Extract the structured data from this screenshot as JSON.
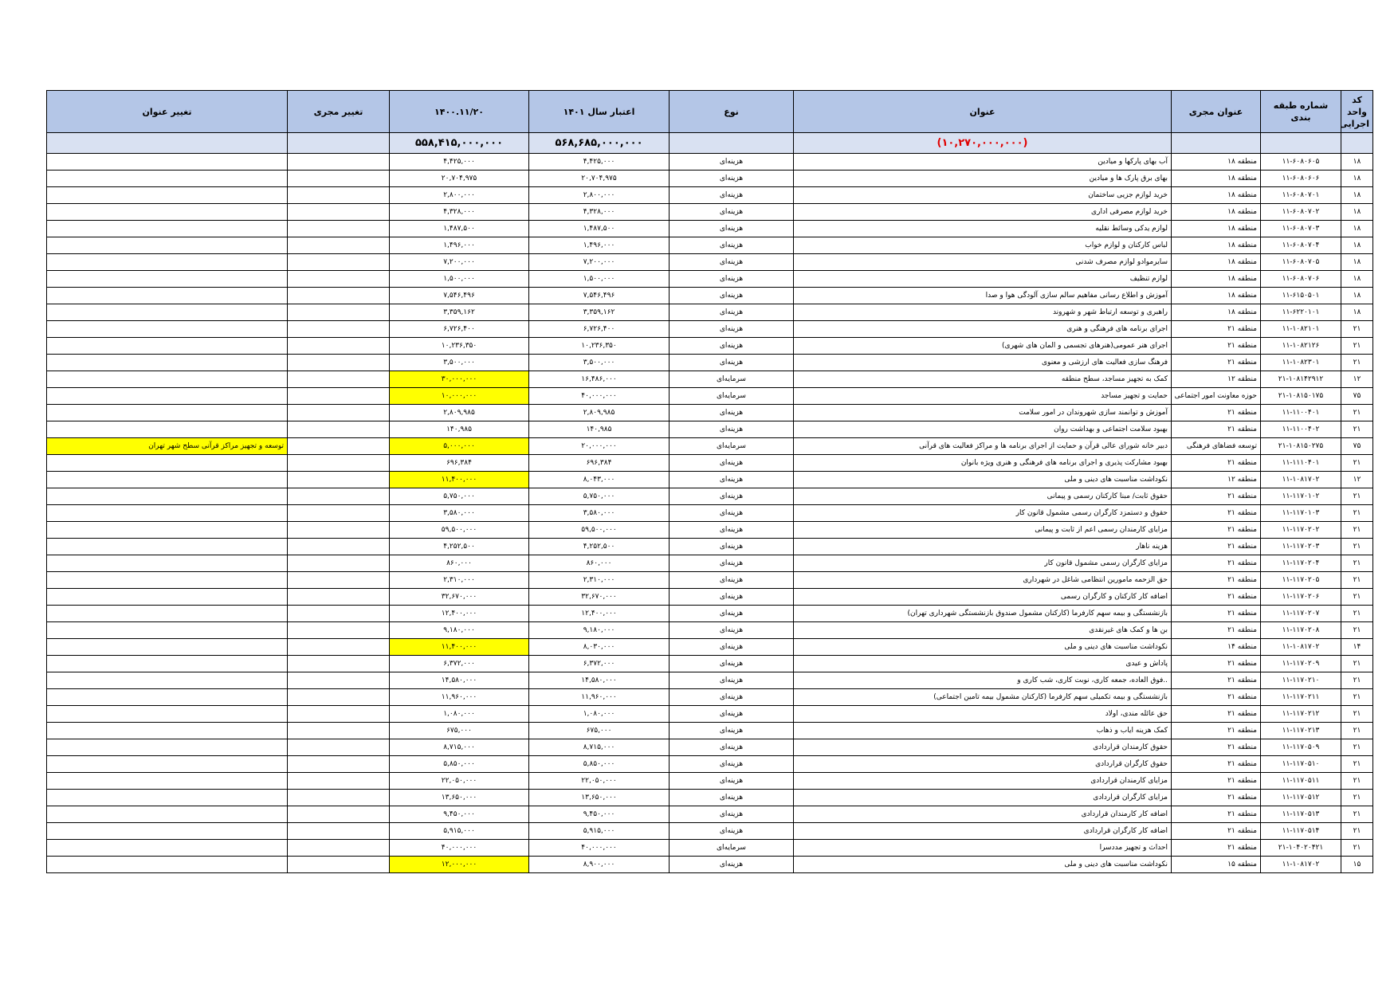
{
  "headers": {
    "code": "کد واحد اجرایی",
    "class_no": "شماره طبقه بندی",
    "unit_title": "عنوان مجری",
    "title": "عنوان",
    "type": "نوع",
    "credit": "اعتبار سال ۱۴۰۱",
    "date_col": "۱۴۰۰.۱۱/۲۰",
    "change_unit": "تغییر مجری",
    "change_title": "تغییر عنوان"
  },
  "totals": {
    "title_total": "(۱۰,۲۷۰,۰۰۰,۰۰۰)",
    "credit_total": "۵۶۸,۶۸۵,۰۰۰,۰۰۰",
    "date_total": "۵۵۸,۴۱۵,۰۰۰,۰۰۰"
  },
  "highlight_color": "#ffff00",
  "header_color": "#b4c6e7",
  "rows": [
    {
      "code": "۱۸",
      "cls": "۱۱-۶۰۸۰۶۰۵",
      "unit": "منطقه ۱۸",
      "title": "آب بهای پارکها و میادین",
      "type": "هزینه‌ای",
      "credit": "۴,۴۲۵,۰۰۰",
      "date": "۴,۴۲۵,۰۰۰",
      "hl": false,
      "ct": ""
    },
    {
      "code": "۱۸",
      "cls": "۱۱-۶۰۸۰۶۰۶",
      "unit": "منطقه ۱۸",
      "title": "بهای برق پارک ها و میادین",
      "type": "هزینه‌ای",
      "credit": "۲۰,۷۰۴,۹۷۵",
      "date": "۲۰,۷۰۴,۹۷۵",
      "hl": false,
      "ct": ""
    },
    {
      "code": "۱۸",
      "cls": "۱۱-۶۰۸۰۷۰۱",
      "unit": "منطقه ۱۸",
      "title": "خرید لوازم جزیی ساختمان",
      "type": "هزینه‌ای",
      "credit": "۲,۸۰۰,۰۰۰",
      "date": "۲,۸۰۰,۰۰۰",
      "hl": false,
      "ct": ""
    },
    {
      "code": "۱۸",
      "cls": "۱۱-۶۰۸۰۷۰۲",
      "unit": "منطقه ۱۸",
      "title": "خرید لوازم مصرفی اداری",
      "type": "هزینه‌ای",
      "credit": "۴,۳۲۸,۰۰۰",
      "date": "۴,۳۲۸,۰۰۰",
      "hl": false,
      "ct": ""
    },
    {
      "code": "۱۸",
      "cls": "۱۱-۶۰۸۰۷۰۳",
      "unit": "منطقه ۱۸",
      "title": "لوازم یدکی وسائط نقلیه",
      "type": "هزینه‌ای",
      "credit": "۱,۴۸۷,۵۰۰",
      "date": "۱,۴۸۷,۵۰۰",
      "hl": false,
      "ct": ""
    },
    {
      "code": "۱۸",
      "cls": "۱۱-۶۰۸۰۷۰۴",
      "unit": "منطقه ۱۸",
      "title": "لباس کارکنان و لوازم خواب",
      "type": "هزینه‌ای",
      "credit": "۱,۴۹۶,۰۰۰",
      "date": "۱,۴۹۶,۰۰۰",
      "hl": false,
      "ct": ""
    },
    {
      "code": "۱۸",
      "cls": "۱۱-۶۰۸۰۷۰۵",
      "unit": "منطقه ۱۸",
      "title": "سایرموادو لوازم مصرف شدنی",
      "type": "هزینه‌ای",
      "credit": "۷,۲۰۰,۰۰۰",
      "date": "۷,۲۰۰,۰۰۰",
      "hl": false,
      "ct": ""
    },
    {
      "code": "۱۸",
      "cls": "۱۱-۶۰۸۰۷۰۶",
      "unit": "منطقه ۱۸",
      "title": "لوازم تنظیف",
      "type": "هزینه‌ای",
      "credit": "۱,۵۰۰,۰۰۰",
      "date": "۱,۵۰۰,۰۰۰",
      "hl": false,
      "ct": ""
    },
    {
      "code": "۱۸",
      "cls": "۱۱-۶۱۵۰۵۰۱",
      "unit": "منطقه ۱۸",
      "title": "آموزش و اطلاع رسانی مفاهیم سالم سازی آلودگی هوا و صدا",
      "type": "هزینه‌ای",
      "credit": "۷,۵۴۶,۴۹۶",
      "date": "۷,۵۴۶,۴۹۶",
      "hl": false,
      "ct": ""
    },
    {
      "code": "۱۸",
      "cls": "۱۱-۶۲۲۰۱۰۱",
      "unit": "منطقه ۱۸",
      "title": "راهبری و توسعه ارتباط شهر و شهروند",
      "type": "هزینه‌ای",
      "credit": "۳,۳۵۹,۱۶۲",
      "date": "۳,۳۵۹,۱۶۲",
      "hl": false,
      "ct": ""
    },
    {
      "code": "۲۱",
      "cls": "۱۱-۱۰۸۲۱۰۱",
      "unit": "منطقه ۲۱",
      "title": "اجرای برنامه های فرهنگی و هنری",
      "type": "هزینه‌ای",
      "credit": "۶,۷۲۶,۴۰۰",
      "date": "۶,۷۲۶,۴۰۰",
      "hl": false,
      "ct": ""
    },
    {
      "code": "۲۱",
      "cls": "۱۱-۱۰۸۲۱۲۶",
      "unit": "منطقه ۲۱",
      "title": "اجرای هنر عمومی(هنرهای تجسمی و المان های شهری)",
      "type": "هزینه‌ای",
      "credit": "۱۰,۲۳۶,۳۵۰",
      "date": "۱۰,۲۳۶,۳۵۰",
      "hl": false,
      "ct": ""
    },
    {
      "code": "۲۱",
      "cls": "۱۱-۱۰۸۲۳۰۱",
      "unit": "منطقه ۲۱",
      "title": "فرهنگ سازی فعالیت های ارزشی و معنوی",
      "type": "هزینه‌ای",
      "credit": "۳,۵۰۰,۰۰۰",
      "date": "۳,۵۰۰,۰۰۰",
      "hl": false,
      "ct": ""
    },
    {
      "code": "۱۲",
      "cls": "۲۱-۱۰۸۱۴۲۹۱۲",
      "unit": "منطقه ۱۲",
      "title": "کمک به تجهیز مساجد، سطح منطقه",
      "type": "سرمایه‌ای",
      "credit": "۱۶,۴۸۶,۰۰۰",
      "date": "۳۰,۰۰۰,۰۰۰",
      "hl": true,
      "ct": ""
    },
    {
      "code": "۷۵",
      "cls": "۲۱-۱۰۸۱۵۰۱۷۵",
      "unit": "حوزه معاونت امور اجتماعی وفرهنگی",
      "title": "حمایت و تجهیز مساجد",
      "type": "سرمایه‌ای",
      "credit": "۴۰,۰۰۰,۰۰۰",
      "date": "۱۰,۰۰۰,۰۰۰",
      "hl": true,
      "ct": ""
    },
    {
      "code": "۲۱",
      "cls": "۱۱-۱۱۰۰۴۰۱",
      "unit": "منطقه ۲۱",
      "title": "آموزش و توانمند سازی شهروندان در امور سلامت",
      "type": "هزینه‌ای",
      "credit": "۲,۸۰۹,۹۸۵",
      "date": "۲,۸۰۹,۹۸۵",
      "hl": false,
      "ct": ""
    },
    {
      "code": "۲۱",
      "cls": "۱۱-۱۱۰۰۴۰۲",
      "unit": "منطقه ۲۱",
      "title": "بهبود سلامت اجتماعی و بهداشت روان",
      "type": "هزینه‌ای",
      "credit": "۱۴۰,۹۸۵",
      "date": "۱۴۰,۹۸۵",
      "hl": false,
      "ct": ""
    },
    {
      "code": "۷۵",
      "cls": "۲۱-۱۰۸۱۵۰۲۷۵",
      "unit": "توسعه فضاهای فرهنگی",
      "title": "دبیر خانه شورای عالی قرآن و حمایت از اجرای برنامه ها و مراکز فعالیت های قرآنی",
      "type": "سرمایه‌ای",
      "credit": "۲۰,۰۰۰,۰۰۰",
      "date": "۵,۰۰۰,۰۰۰",
      "hl": true,
      "ct": "توسعه و تجهیز مراکز قرآنی سطح شهر تهران"
    },
    {
      "code": "۲۱",
      "cls": "۱۱-۱۱۱۰۴۰۱",
      "unit": "منطقه ۲۱",
      "title": "بهبود مشارکت پذیری و اجرای برنامه های فرهنگی و هنری ویژه بانوان",
      "type": "هزینه‌ای",
      "credit": "۶۹۶,۳۸۴",
      "date": "۶۹۶,۳۸۴",
      "hl": false,
      "ct": ""
    },
    {
      "code": "۱۲",
      "cls": "۱۱-۱۰۸۱۷۰۲",
      "unit": "منطقه ۱۲",
      "title": "نکوداشت مناسبت های دینی و ملی",
      "type": "هزینه‌ای",
      "credit": "۸,۰۴۳,۰۰۰",
      "date": "۱۱,۴۰۰,۰۰۰",
      "hl": true,
      "ct": ""
    },
    {
      "code": "۲۱",
      "cls": "۱۱-۱۱۷۰۱۰۲",
      "unit": "منطقه ۲۱",
      "title": "حقوق ثابت/ مبنا کارکنان رسمی و پیمانی",
      "type": "هزینه‌ای",
      "credit": "۵,۷۵۰,۰۰۰",
      "date": "۵,۷۵۰,۰۰۰",
      "hl": false,
      "ct": ""
    },
    {
      "code": "۲۱",
      "cls": "۱۱-۱۱۷۰۱۰۳",
      "unit": "منطقه ۲۱",
      "title": "حقوق و دستمزد کارگران رسمی مشمول قانون کار",
      "type": "هزینه‌ای",
      "credit": "۳,۵۸۰,۰۰۰",
      "date": "۳,۵۸۰,۰۰۰",
      "hl": false,
      "ct": ""
    },
    {
      "code": "۲۱",
      "cls": "۱۱-۱۱۷۰۲۰۲",
      "unit": "منطقه ۲۱",
      "title": "مزایای کارمندان رسمی اعم از ثابت و پیمانی",
      "type": "هزینه‌ای",
      "credit": "۵۹,۵۰۰,۰۰۰",
      "date": "۵۹,۵۰۰,۰۰۰",
      "hl": false,
      "ct": ""
    },
    {
      "code": "۲۱",
      "cls": "۱۱-۱۱۷۰۲۰۳",
      "unit": "منطقه ۲۱",
      "title": "هزینه ناهار",
      "type": "هزینه‌ای",
      "credit": "۴,۲۵۲,۵۰۰",
      "date": "۴,۲۵۲,۵۰۰",
      "hl": false,
      "ct": ""
    },
    {
      "code": "۲۱",
      "cls": "۱۱-۱۱۷۰۲۰۴",
      "unit": "منطقه ۲۱",
      "title": "مزایای کارگران رسمی مشمول قانون کار",
      "type": "هزینه‌ای",
      "credit": "۸۶۰,۰۰۰",
      "date": "۸۶۰,۰۰۰",
      "hl": false,
      "ct": ""
    },
    {
      "code": "۲۱",
      "cls": "۱۱-۱۱۷۰۲۰۵",
      "unit": "منطقه ۲۱",
      "title": "حق الزحمه مامورین انتظامی شاغل در شهرداری",
      "type": "هزینه‌ای",
      "credit": "۲,۳۱۰,۰۰۰",
      "date": "۲,۳۱۰,۰۰۰",
      "hl": false,
      "ct": ""
    },
    {
      "code": "۲۱",
      "cls": "۱۱-۱۱۷۰۲۰۶",
      "unit": "منطقه ۲۱",
      "title": "اضافه کار کارکنان و کارگران رسمی",
      "type": "هزینه‌ای",
      "credit": "۳۲,۶۷۰,۰۰۰",
      "date": "۳۲,۶۷۰,۰۰۰",
      "hl": false,
      "ct": ""
    },
    {
      "code": "۲۱",
      "cls": "۱۱-۱۱۷۰۲۰۷",
      "unit": "منطقه ۲۱",
      "title": "بازنشستگی و بیمه سهم کارفرما (کارکنان مشمول صندوق بازنشستگی شهرداری تهران)",
      "type": "هزینه‌ای",
      "credit": "۱۲,۴۰۰,۰۰۰",
      "date": "۱۲,۴۰۰,۰۰۰",
      "hl": false,
      "ct": ""
    },
    {
      "code": "۲۱",
      "cls": "۱۱-۱۱۷۰۲۰۸",
      "unit": "منطقه ۲۱",
      "title": "بن ها و کمک های غیرنقدی",
      "type": "هزینه‌ای",
      "credit": "۹,۱۸۰,۰۰۰",
      "date": "۹,۱۸۰,۰۰۰",
      "hl": false,
      "ct": ""
    },
    {
      "code": "۱۴",
      "cls": "۱۱-۱۰۸۱۷۰۲",
      "unit": "منطقه ۱۴",
      "title": "نکوداشت مناسبت های دینی و ملی",
      "type": "هزینه‌ای",
      "credit": "۸,۰۳۰,۰۰۰",
      "date": "۱۱,۴۰۰,۰۰۰",
      "hl": true,
      "ct": ""
    },
    {
      "code": "۲۱",
      "cls": "۱۱-۱۱۷۰۲۰۹",
      "unit": "منطقه ۲۱",
      "title": "پاداش و عیدی",
      "type": "هزینه‌ای",
      "credit": "۶,۳۷۲,۰۰۰",
      "date": "۶,۳۷۲,۰۰۰",
      "hl": false,
      "ct": ""
    },
    {
      "code": "۲۱",
      "cls": "۱۱-۱۱۷۰۲۱۰",
      "unit": "منطقه ۲۱",
      "title": "..فوق العاده، جمعه کاری، نوبت کاری، شب کاری و",
      "type": "هزینه‌ای",
      "credit": "۱۴,۵۸۰,۰۰۰",
      "date": "۱۴,۵۸۰,۰۰۰",
      "hl": false,
      "ct": ""
    },
    {
      "code": "۲۱",
      "cls": "۱۱-۱۱۷۰۲۱۱",
      "unit": "منطقه ۲۱",
      "title": "بازنشستگی و بیمه تکمیلی سهم کارفرما (کارکنان مشمول بیمه تامین اجتماعی)",
      "type": "هزینه‌ای",
      "credit": "۱۱,۹۶۰,۰۰۰",
      "date": "۱۱,۹۶۰,۰۰۰",
      "hl": false,
      "ct": ""
    },
    {
      "code": "۲۱",
      "cls": "۱۱-۱۱۷۰۲۱۲",
      "unit": "منطقه ۲۱",
      "title": "حق عائله مندی، اولاد",
      "type": "هزینه‌ای",
      "credit": "۱,۰۸۰,۰۰۰",
      "date": "۱,۰۸۰,۰۰۰",
      "hl": false,
      "ct": ""
    },
    {
      "code": "۲۱",
      "cls": "۱۱-۱۱۷۰۲۱۳",
      "unit": "منطقه ۲۱",
      "title": "کمک هزینه ایاب و ذهاب",
      "type": "هزینه‌ای",
      "credit": "۶۷۵,۰۰۰",
      "date": "۶۷۵,۰۰۰",
      "hl": false,
      "ct": ""
    },
    {
      "code": "۲۱",
      "cls": "۱۱-۱۱۷۰۵۰۹",
      "unit": "منطقه ۲۱",
      "title": "حقوق کارمندان قراردادی",
      "type": "هزینه‌ای",
      "credit": "۸,۷۱۵,۰۰۰",
      "date": "۸,۷۱۵,۰۰۰",
      "hl": false,
      "ct": ""
    },
    {
      "code": "۲۱",
      "cls": "۱۱-۱۱۷۰۵۱۰",
      "unit": "منطقه ۲۱",
      "title": "حقوق کارگران قراردادی",
      "type": "هزینه‌ای",
      "credit": "۵,۸۵۰,۰۰۰",
      "date": "۵,۸۵۰,۰۰۰",
      "hl": false,
      "ct": ""
    },
    {
      "code": "۲۱",
      "cls": "۱۱-۱۱۷۰۵۱۱",
      "unit": "منطقه ۲۱",
      "title": "مزایای کارمندان قراردادی",
      "type": "هزینه‌ای",
      "credit": "۲۲,۰۵۰,۰۰۰",
      "date": "۲۲,۰۵۰,۰۰۰",
      "hl": false,
      "ct": ""
    },
    {
      "code": "۲۱",
      "cls": "۱۱-۱۱۷۰۵۱۲",
      "unit": "منطقه ۲۱",
      "title": "مزایای کارگران قراردادی",
      "type": "هزینه‌ای",
      "credit": "۱۳,۶۵۰,۰۰۰",
      "date": "۱۳,۶۵۰,۰۰۰",
      "hl": false,
      "ct": ""
    },
    {
      "code": "۲۱",
      "cls": "۱۱-۱۱۷۰۵۱۳",
      "unit": "منطقه ۲۱",
      "title": "اضافه کار کارمندان قراردادی",
      "type": "هزینه‌ای",
      "credit": "۹,۴۵۰,۰۰۰",
      "date": "۹,۴۵۰,۰۰۰",
      "hl": false,
      "ct": ""
    },
    {
      "code": "۲۱",
      "cls": "۱۱-۱۱۷۰۵۱۴",
      "unit": "منطقه ۲۱",
      "title": "اضافه کار کارگران قراردادی",
      "type": "هزینه‌ای",
      "credit": "۵,۹۱۵,۰۰۰",
      "date": "۵,۹۱۵,۰۰۰",
      "hl": false,
      "ct": ""
    },
    {
      "code": "۲۱",
      "cls": "۲۱-۱۰۴۰۲۰۴۲۱",
      "unit": "منطقه ۲۱",
      "title": "احداث و تجهیز مددسرا",
      "type": "سرمایه‌ای",
      "credit": "۴۰,۰۰۰,۰۰۰",
      "date": "۴۰,۰۰۰,۰۰۰",
      "hl": false,
      "ct": ""
    },
    {
      "code": "۱۵",
      "cls": "۱۱-۱۰۸۱۷۰۲",
      "unit": "منطقه ۱۵",
      "title": "نکوداشت مناسبت های دینی و ملی",
      "type": "هزینه‌ای",
      "credit": "۸,۹۰۰,۰۰۰",
      "date": "۱۲,۰۰۰,۰۰۰",
      "hl": true,
      "ct": ""
    }
  ]
}
